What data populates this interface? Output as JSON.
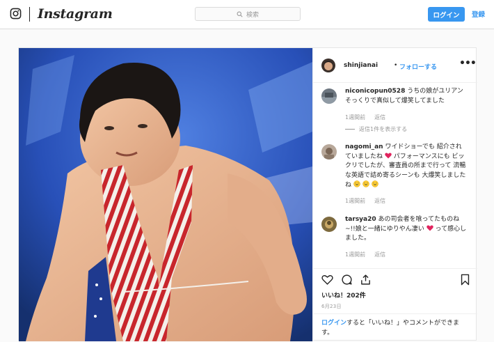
{
  "nav": {
    "brand": "Instagram",
    "search_placeholder": "検索",
    "login_label": "ログイン",
    "signup_label": "登録"
  },
  "post": {
    "header": {
      "username": "shinjianai",
      "separator": "•",
      "follow_label": "フォローする",
      "more_label": "•••"
    },
    "comments": [
      {
        "username": "niconicopun0528",
        "text": "うちの娘がユリアンそっくりで真似して爆笑してました",
        "time": "1週間前",
        "reply_label": "返信",
        "view_replies": "返信1件を表示する"
      },
      {
        "username": "nagomi_an",
        "text_a": "ワイドショーでも 紹介されていましたね",
        "text_b": "パフォーマンスにも ビックリでしたが、審査員の所まで行って 流暢な英語で詰め寄るシーンも 大爆笑しましたね",
        "time": "1週間前",
        "reply_label": "返信"
      },
      {
        "username": "tarsya20",
        "text_a": "あの司会者を喰ってたものね~!!娘と一緒にゆりやん凄い",
        "text_b": "って感心しました。",
        "time": "1週間前",
        "reply_label": "返信"
      }
    ],
    "likes_text": "いいね！202件",
    "date": "6月23日",
    "login_link": "ログイン",
    "login_note": "すると「いいね！」やコメントができます。"
  },
  "colors": {
    "accent": "#3897f0",
    "text": "#262626",
    "muted": "#999999",
    "border": "#dbdbdb"
  },
  "icons": [
    "instagram-glyph-icon",
    "search-icon",
    "more-options-icon",
    "heart-icon",
    "comment-icon",
    "share-icon",
    "bookmark-icon",
    "red-heart-emoji",
    "laughing-emoji"
  ]
}
